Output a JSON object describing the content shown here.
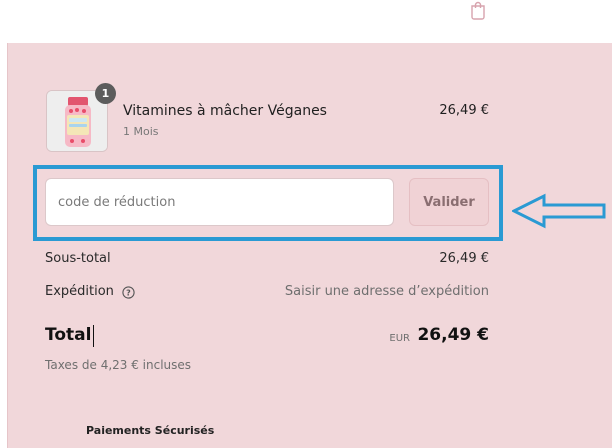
{
  "header": {
    "bag_icon": "shopping-bag-icon"
  },
  "cart": {
    "quantity_badge": "1",
    "item_name": "Vitamines à mâcher Véganes",
    "item_variant": "1 Mois",
    "item_price": "26,49 €"
  },
  "discount": {
    "placeholder": "code de réduction",
    "value": "",
    "apply_label": "Valider",
    "highlight_color": "#2a9ad3"
  },
  "summary": {
    "subtotal_label": "Sous-total",
    "subtotal_value": "26,49 €",
    "shipping_label": "Expédition",
    "shipping_help_icon": "question-circle-icon",
    "shipping_value": "Saisir une adresse d’expédition",
    "total_label": "Total",
    "currency": "EUR",
    "total_value": "26,49 €",
    "tax_note": "Taxes de 4,23 € incluses"
  },
  "footer": {
    "secure_payments_title": "Paiements Sécurisés"
  },
  "colors": {
    "panel_background": "#f1d7da",
    "arrow": "#2a9ad3"
  }
}
